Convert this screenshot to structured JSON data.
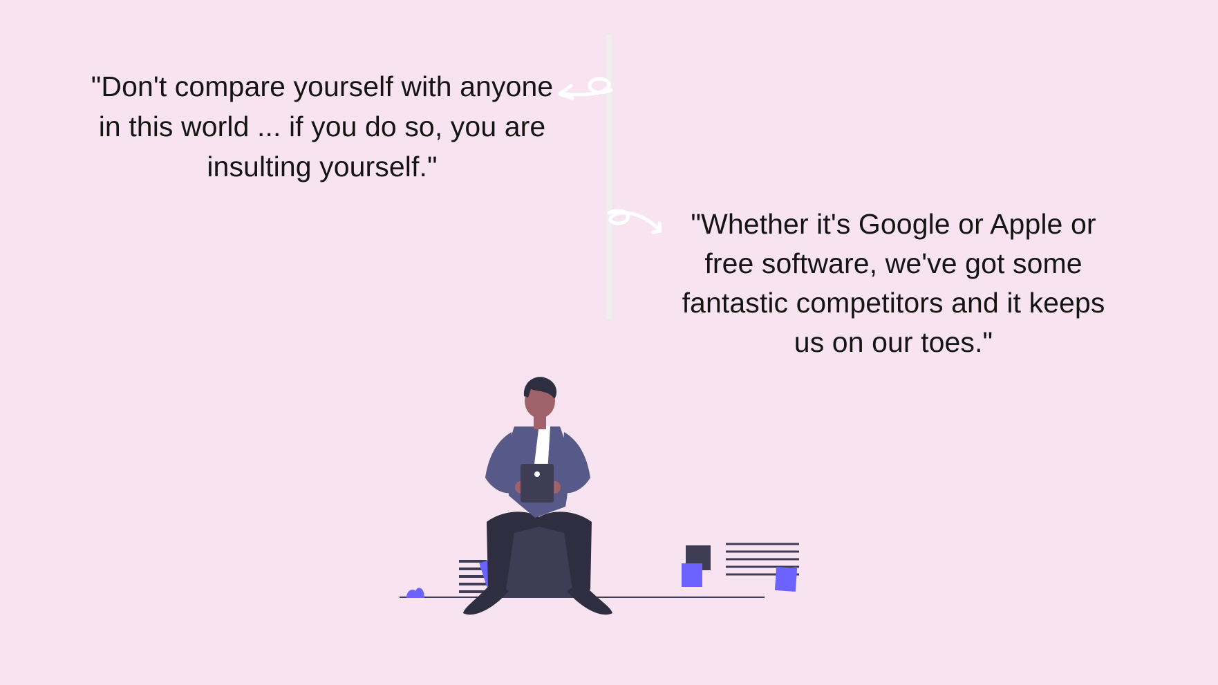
{
  "quotes": {
    "left": "\"Don't compare yourself with anyone in this world ... if you do so, you are insulting yourself.\"",
    "right": "\"Whether it's Google or Apple or free software, we've got some fantastic competitors and it keeps us on our toes.\""
  },
  "icons": {
    "left_arrow": "curved-arrow-left-icon",
    "right_arrow": "curved-arrow-right-icon"
  },
  "colors": {
    "background": "#f7e4f0",
    "text": "#141414",
    "divider": "#efefef",
    "accent": "#6c63ff",
    "dark": "#3f3d56"
  }
}
